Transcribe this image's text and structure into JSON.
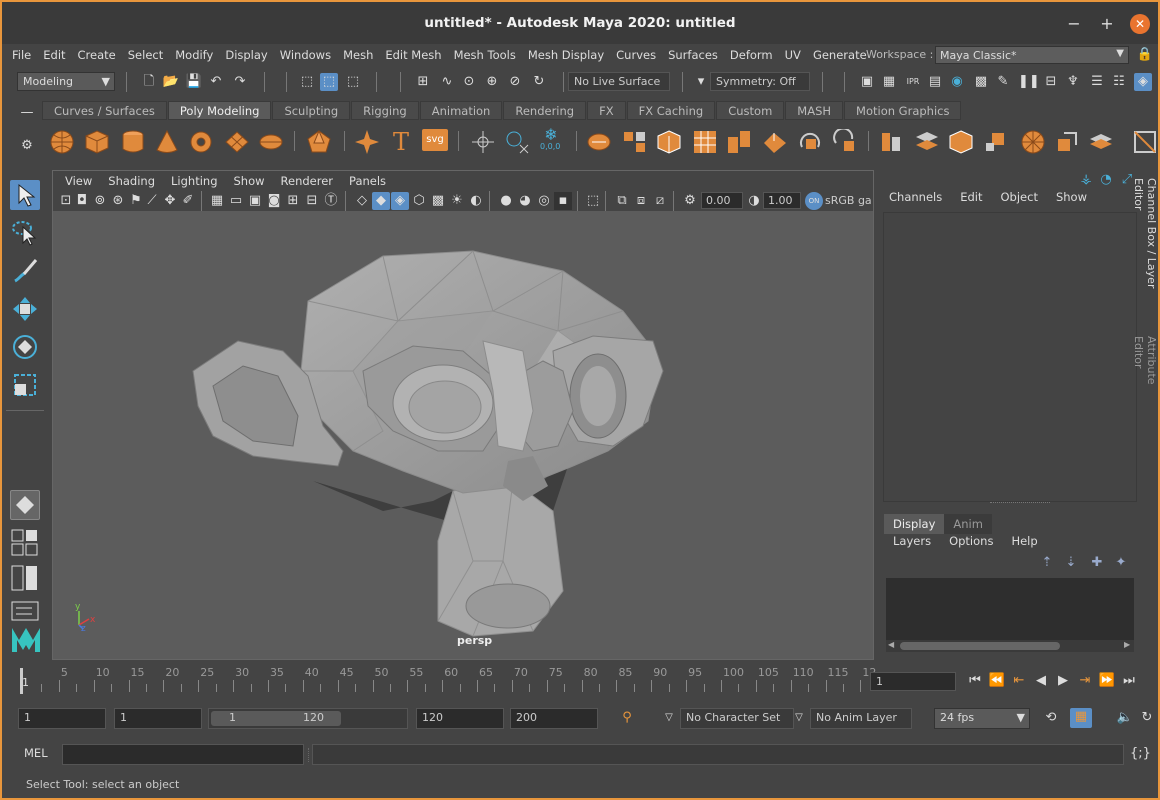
{
  "window": {
    "title": "untitled* - Autodesk Maya 2020: untitled",
    "accent": "#e8963c"
  },
  "menubar": [
    "File",
    "Edit",
    "Create",
    "Select",
    "Modify",
    "Display",
    "Windows",
    "Mesh",
    "Edit Mesh",
    "Mesh Tools",
    "Mesh Display",
    "Curves",
    "Surfaces",
    "Deform",
    "UV",
    "Generate"
  ],
  "workspace": {
    "label": "Workspace :",
    "value": "Maya Classic*"
  },
  "statusline": {
    "menuset": "Modeling",
    "live_surface": "No Live Surface",
    "symmetry": "Symmetry: Off"
  },
  "shelf": {
    "tabs": [
      "Curves / Surfaces",
      "Poly Modeling",
      "Sculpting",
      "Rigging",
      "Animation",
      "Rendering",
      "FX",
      "FX Caching",
      "Custom",
      "MASH",
      "Motion Graphics"
    ],
    "active_tab": "Poly Modeling",
    "text_icons": {
      "text_tool": "T",
      "svg_tool": "svg",
      "snowflake_label": "0,0,0"
    }
  },
  "viewport": {
    "menu": [
      "View",
      "Shading",
      "Lighting",
      "Show",
      "Renderer",
      "Panels"
    ],
    "exposure": "0.00",
    "gamma": "1.00",
    "colorspace": "sRGB ga",
    "camera": "persp",
    "axis": {
      "y": "y",
      "z": "z",
      "x": "x"
    }
  },
  "channel_box": {
    "menu": [
      "Channels",
      "Edit",
      "Object",
      "Show"
    ]
  },
  "layer_editor": {
    "tabs": [
      "Display",
      "Anim"
    ],
    "active_tab": "Display",
    "menu": [
      "Layers",
      "Options",
      "Help"
    ]
  },
  "side_tabs": [
    "Channel Box / Layer Editor",
    "Attribute Editor"
  ],
  "timeline": {
    "start_label": "1",
    "ticks": [
      "5",
      "10",
      "15",
      "20",
      "25",
      "30",
      "35",
      "40",
      "45",
      "50",
      "55",
      "60",
      "65",
      "70",
      "75",
      "80",
      "85",
      "90",
      "95",
      "100",
      "105",
      "110",
      "115",
      "12"
    ],
    "current_frame": "1"
  },
  "range": {
    "start": "1",
    "playback_start": "1",
    "slider_start": "1",
    "slider_end": "120",
    "playback_end": "120",
    "end": "200",
    "character_set": "No Character Set",
    "anim_layer": "No Anim Layer",
    "fps": "24 fps"
  },
  "command": {
    "lang": "MEL"
  },
  "help_line": "Select Tool: select an object"
}
